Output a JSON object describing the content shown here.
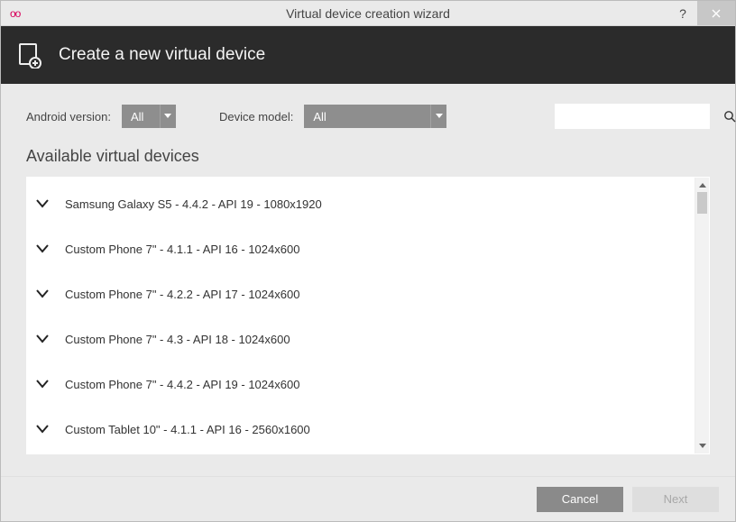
{
  "titlebar": {
    "brand": "oo",
    "title": "Virtual device creation wizard",
    "help_tooltip": "?",
    "close_tooltip": "×"
  },
  "banner": {
    "heading": "Create a new virtual device"
  },
  "filters": {
    "android_label": "Android version:",
    "android_value": "All",
    "model_label": "Device model:",
    "model_value": "All",
    "search_value": ""
  },
  "section_title": "Available virtual devices",
  "devices": [
    {
      "label": "Samsung Galaxy S5 - 4.4.2 - API 19 - 1080x1920"
    },
    {
      "label": "Custom Phone 7\" - 4.1.1 - API 16 - 1024x600"
    },
    {
      "label": "Custom Phone 7\" - 4.2.2 - API 17 - 1024x600"
    },
    {
      "label": "Custom Phone 7\" - 4.3 - API 18 - 1024x600"
    },
    {
      "label": "Custom Phone 7\" - 4.4.2 - API 19 - 1024x600"
    },
    {
      "label": "Custom Tablet 10\" - 4.1.1 - API 16 - 2560x1600"
    }
  ],
  "footer": {
    "cancel": "Cancel",
    "next": "Next"
  }
}
